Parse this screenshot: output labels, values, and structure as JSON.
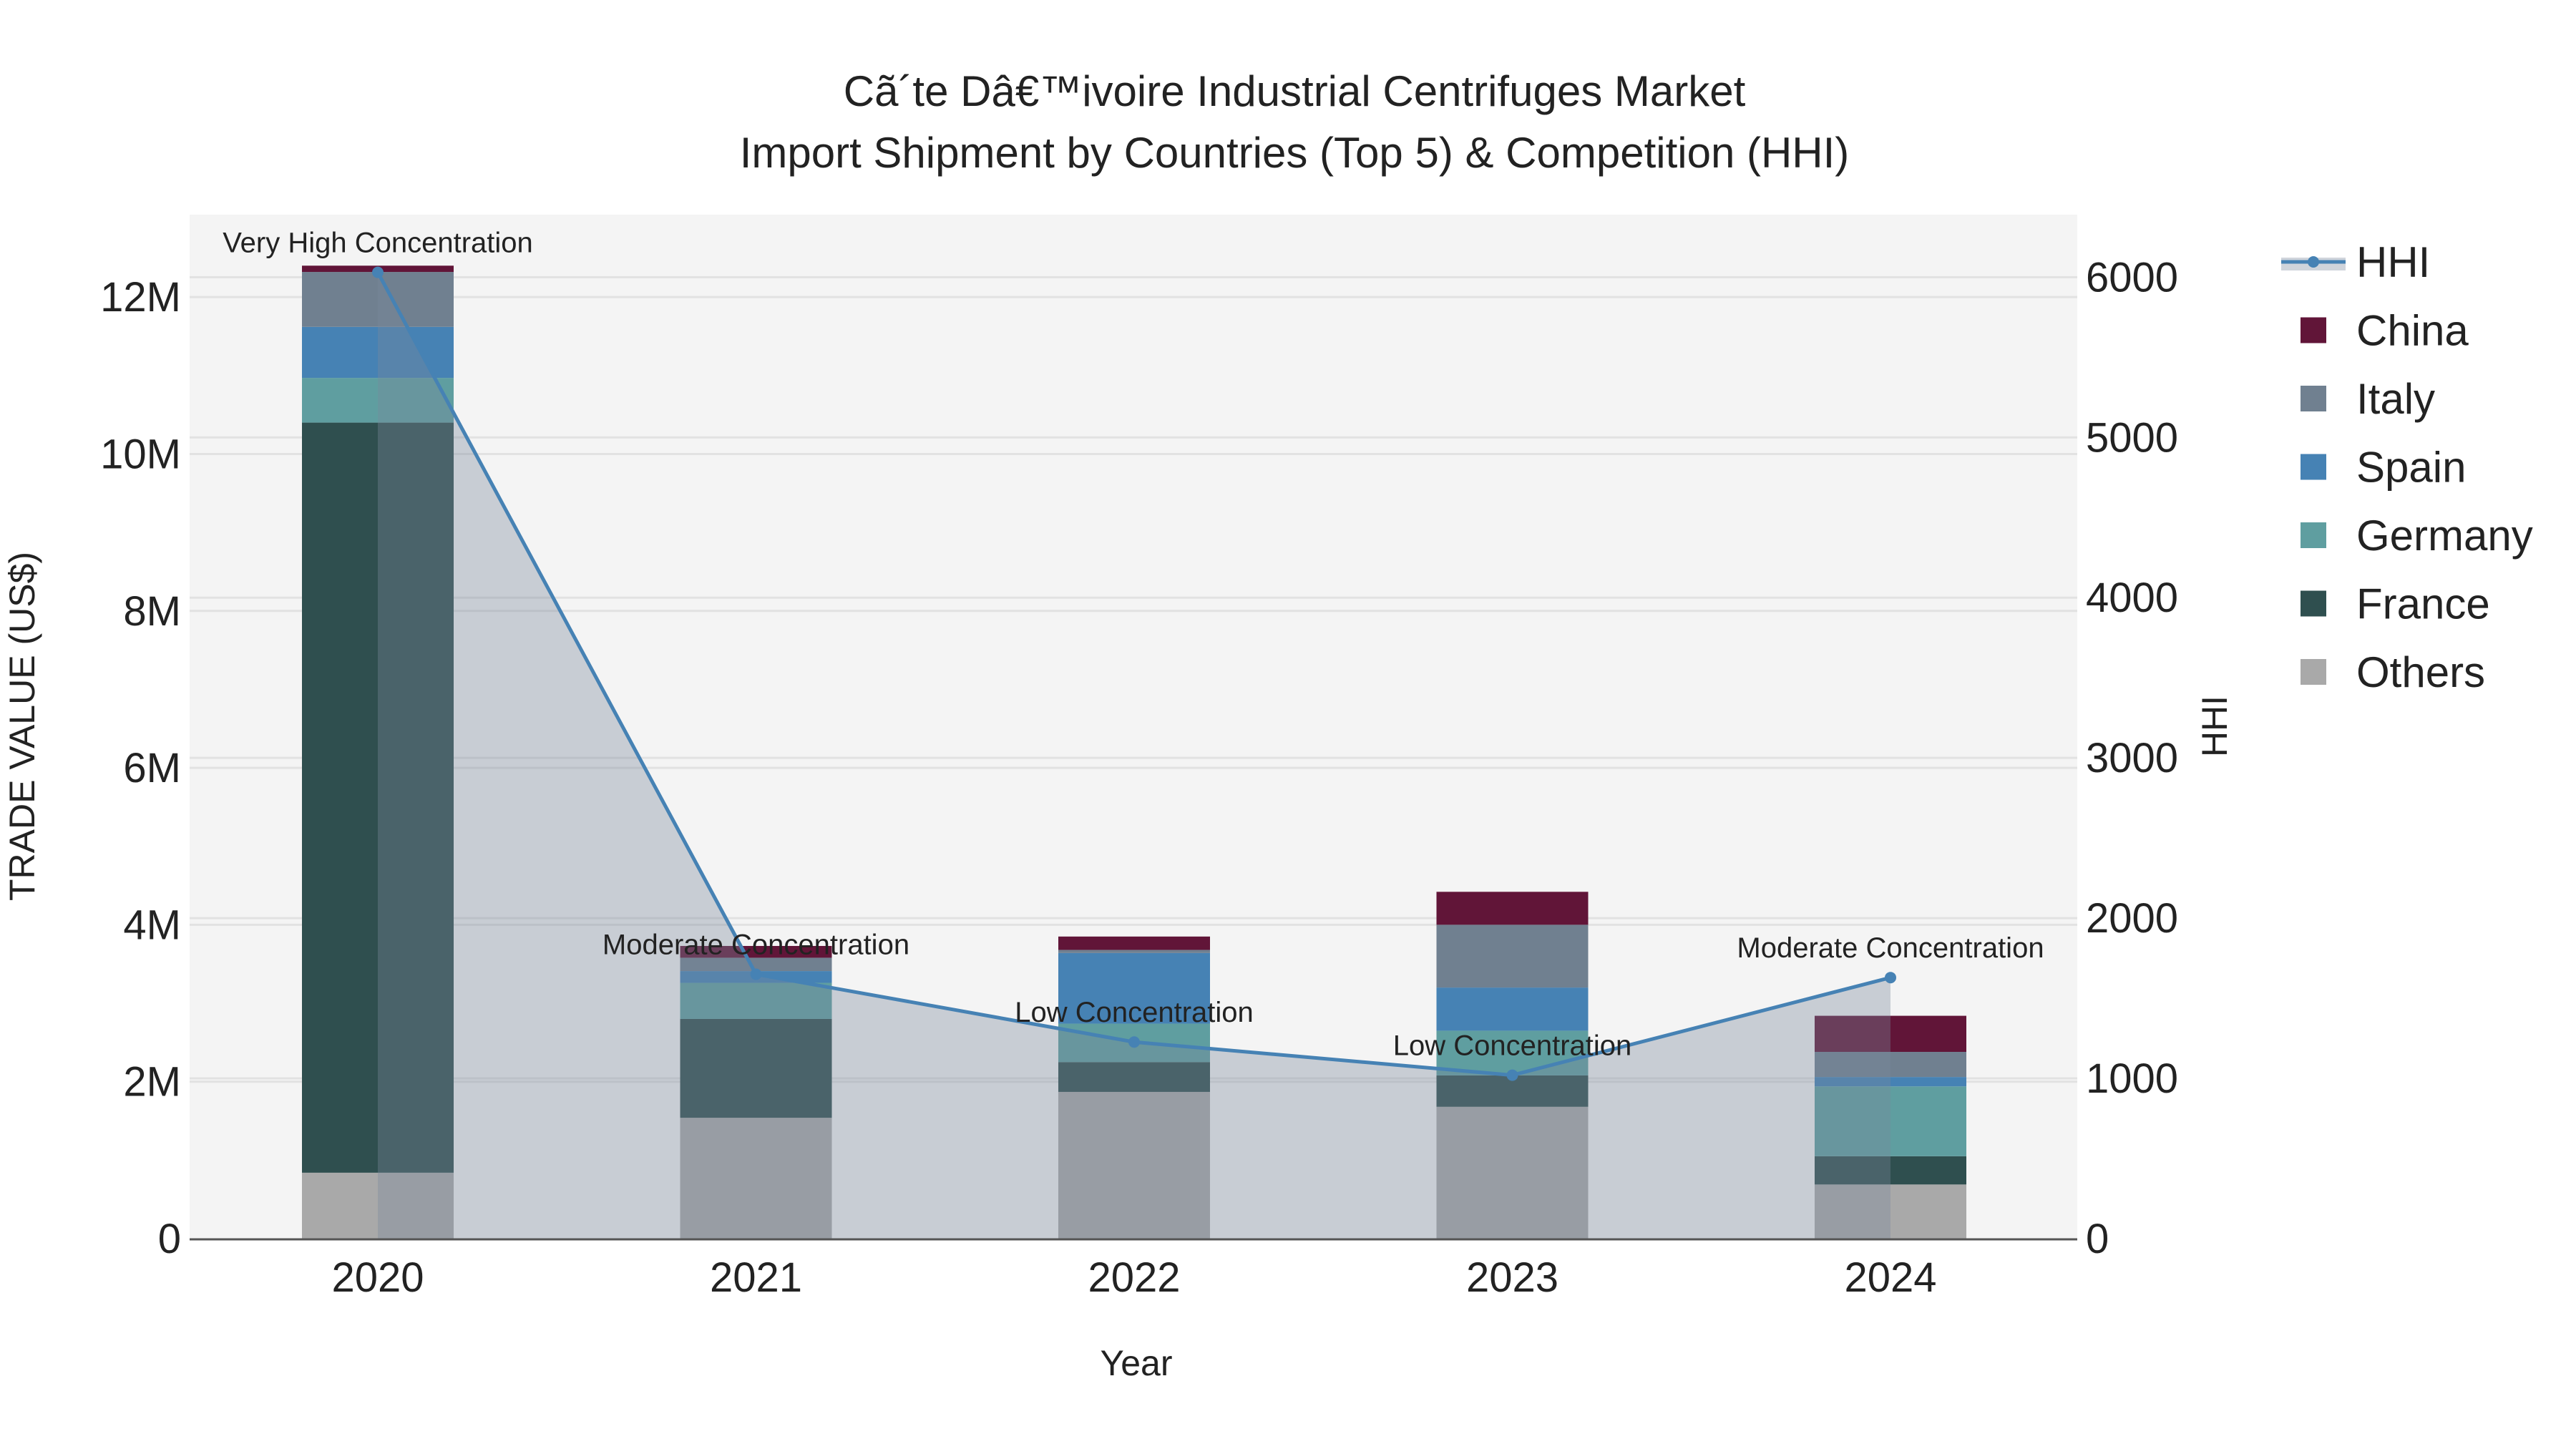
{
  "chart_data": {
    "type": "bar",
    "title_line1": "Cã´te Dâ€™ivoire Industrial Centrifuges Market",
    "title_line2": "Import Shipment by Countries (Top 5) & Competition (HHI)",
    "xlabel": "Year",
    "ylabel": "TRADE VALUE (US$)",
    "y2label": "HHI",
    "categories": [
      "2020",
      "2021",
      "2022",
      "2023",
      "2024"
    ],
    "ylim": [
      0,
      13050000
    ],
    "y2lim": [
      0,
      6390
    ],
    "yticks": [
      0,
      2000000,
      4000000,
      6000000,
      8000000,
      10000000,
      12000000
    ],
    "ytick_labels": [
      "0",
      "2M",
      "4M",
      "6M",
      "8M",
      "10M",
      "12M"
    ],
    "y2ticks": [
      0,
      1000,
      2000,
      3000,
      4000,
      5000,
      6000
    ],
    "y2tick_labels": [
      "0",
      "1000",
      "2000",
      "3000",
      "4000",
      "5000",
      "6000"
    ],
    "grid": true,
    "legend_position": "right",
    "series": [
      {
        "name": "Others",
        "color": "#a9a9a9",
        "values": [
          840000,
          1540000,
          1870000,
          1680000,
          690000
        ]
      },
      {
        "name": "France",
        "color": "#2f4f4f",
        "values": [
          9560000,
          1260000,
          380000,
          400000,
          360000
        ]
      },
      {
        "name": "Germany",
        "color": "#5f9ea0",
        "values": [
          570000,
          460000,
          490000,
          570000,
          890000
        ]
      },
      {
        "name": "Spain",
        "color": "#4682b4",
        "values": [
          650000,
          150000,
          900000,
          550000,
          120000
        ]
      },
      {
        "name": "Italy",
        "color": "#708090",
        "values": [
          700000,
          170000,
          40000,
          800000,
          320000
        ]
      },
      {
        "name": "China",
        "color": "#611538",
        "values": [
          80000,
          150000,
          170000,
          420000,
          460000
        ]
      }
    ],
    "hhi": {
      "name": "HHI",
      "color": "#4682b4",
      "values": [
        6030,
        1650,
        1227,
        1020,
        1629
      ],
      "annotations": [
        "Very High Concentration",
        "Moderate Concentration",
        "Low Concentration",
        "Low Concentration",
        "Moderate Concentration"
      ]
    },
    "legend": [
      "HHI",
      "China",
      "Italy",
      "Spain",
      "Germany",
      "France",
      "Others"
    ]
  }
}
